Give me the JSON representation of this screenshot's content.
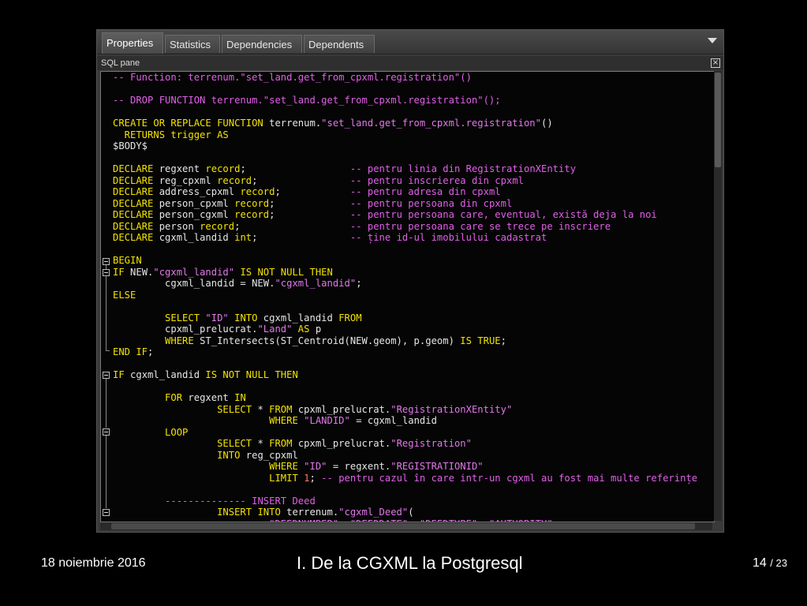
{
  "tabs": [
    {
      "label": "Properties",
      "active": true
    },
    {
      "label": "Statistics"
    },
    {
      "label": "Dependencies"
    },
    {
      "label": "Dependents"
    }
  ],
  "pane": {
    "title": "SQL pane",
    "close_icon": "close-icon"
  },
  "code_lines": [
    [
      [
        "cm",
        "-- Function: terrenum.\"set_land.get_from_cpxml.registration\"()"
      ]
    ],
    [],
    [
      [
        "cm",
        "-- DROP FUNCTION terrenum.\"set_land.get_from_cpxml.registration\"();"
      ]
    ],
    [],
    [
      [
        "kw",
        "CREATE OR REPLACE FUNCTION"
      ],
      [
        "t",
        " terrenum."
      ],
      [
        "str",
        "\"set_land.get_from_cpxml.registration\""
      ],
      [
        "t",
        "()"
      ]
    ],
    [
      [
        "kw",
        "  RETURNS trigger AS"
      ]
    ],
    [
      [
        "t",
        "$BODY$"
      ]
    ],
    [],
    [
      [
        "kw",
        "DECLARE"
      ],
      [
        "t",
        " regxent "
      ],
      [
        "kw",
        "record"
      ],
      [
        "t",
        ";                  "
      ],
      [
        "cm",
        "-- pentru linia din RegistrationXEntity"
      ]
    ],
    [
      [
        "kw",
        "DECLARE"
      ],
      [
        "t",
        " reg_cpxml "
      ],
      [
        "kw",
        "record"
      ],
      [
        "t",
        ";                "
      ],
      [
        "cm",
        "-- pentru inscrierea din cpxml"
      ]
    ],
    [
      [
        "kw",
        "DECLARE"
      ],
      [
        "t",
        " address_cpxml "
      ],
      [
        "kw",
        "record"
      ],
      [
        "t",
        ";            "
      ],
      [
        "cm",
        "-- pentru adresa din cpxml"
      ]
    ],
    [
      [
        "kw",
        "DECLARE"
      ],
      [
        "t",
        " person_cpxml "
      ],
      [
        "kw",
        "record"
      ],
      [
        "t",
        ";             "
      ],
      [
        "cm",
        "-- pentru persoana din cpxml"
      ]
    ],
    [
      [
        "kw",
        "DECLARE"
      ],
      [
        "t",
        " person_cgxml "
      ],
      [
        "kw",
        "record"
      ],
      [
        "t",
        ";             "
      ],
      [
        "cm",
        "-- pentru persoana care, eventual, există deja la noi"
      ]
    ],
    [
      [
        "kw",
        "DECLARE"
      ],
      [
        "t",
        " person "
      ],
      [
        "kw",
        "record"
      ],
      [
        "t",
        ";                   "
      ],
      [
        "cm",
        "-- pentru persoana care se trece pe inscriere"
      ]
    ],
    [
      [
        "kw",
        "DECLARE"
      ],
      [
        "t",
        " cgxml_landid "
      ],
      [
        "kw",
        "int"
      ],
      [
        "t",
        ";                "
      ],
      [
        "cm",
        "-- ține id-ul imobilului cadastrat"
      ]
    ],
    [],
    [
      [
        "kw",
        "BEGIN"
      ]
    ],
    [
      [
        "kw",
        "IF"
      ],
      [
        "t",
        " NEW."
      ],
      [
        "str",
        "\"cgxml_landid\""
      ],
      [
        "kw",
        " IS NOT NULL THEN"
      ]
    ],
    [
      [
        "t",
        "         cgxml_landid = NEW."
      ],
      [
        "str",
        "\"cgxml_landid\""
      ],
      [
        "t",
        ";"
      ]
    ],
    [
      [
        "kw",
        "ELSE"
      ]
    ],
    [],
    [
      [
        "t",
        "         "
      ],
      [
        "kw",
        "SELECT"
      ],
      [
        "t",
        " "
      ],
      [
        "str",
        "\"ID\""
      ],
      [
        "kw",
        " INTO"
      ],
      [
        "t",
        " cgxml_landid "
      ],
      [
        "kw",
        "FROM"
      ]
    ],
    [
      [
        "t",
        "         cpxml_prelucrat."
      ],
      [
        "str",
        "\"Land\""
      ],
      [
        "kw",
        " AS"
      ],
      [
        "t",
        " p"
      ]
    ],
    [
      [
        "t",
        "         "
      ],
      [
        "kw",
        "WHERE"
      ],
      [
        "t",
        " ST_Intersects(ST_Centroid(NEW.geom), p.geom) "
      ],
      [
        "kw",
        "IS TRUE"
      ],
      [
        "t",
        ";"
      ]
    ],
    [
      [
        "kw",
        "END IF"
      ],
      [
        "t",
        ";"
      ]
    ],
    [],
    [
      [
        "kw",
        "IF"
      ],
      [
        "t",
        " cgxml_landid "
      ],
      [
        "kw",
        "IS NOT NULL THEN"
      ]
    ],
    [],
    [
      [
        "t",
        "         "
      ],
      [
        "kw",
        "FOR"
      ],
      [
        "t",
        " regxent "
      ],
      [
        "kw",
        "IN"
      ]
    ],
    [
      [
        "t",
        "                  "
      ],
      [
        "kw",
        "SELECT"
      ],
      [
        "t",
        " * "
      ],
      [
        "kw",
        "FROM"
      ],
      [
        "t",
        " cpxml_prelucrat."
      ],
      [
        "str",
        "\"RegistrationXEntity\""
      ]
    ],
    [
      [
        "t",
        "                           "
      ],
      [
        "kw",
        "WHERE"
      ],
      [
        "t",
        " "
      ],
      [
        "str",
        "\"LANDID\""
      ],
      [
        "t",
        " = cgxml_landid"
      ]
    ],
    [
      [
        "t",
        "         "
      ],
      [
        "kw",
        "LOOP"
      ]
    ],
    [
      [
        "t",
        "                  "
      ],
      [
        "kw",
        "SELECT"
      ],
      [
        "t",
        " * "
      ],
      [
        "kw",
        "FROM"
      ],
      [
        "t",
        " cpxml_prelucrat."
      ],
      [
        "str",
        "\"Registration\""
      ]
    ],
    [
      [
        "t",
        "                  "
      ],
      [
        "kw",
        "INTO"
      ],
      [
        "t",
        " reg_cpxml"
      ]
    ],
    [
      [
        "t",
        "                           "
      ],
      [
        "kw",
        "WHERE"
      ],
      [
        "t",
        " "
      ],
      [
        "str",
        "\"ID\""
      ],
      [
        "t",
        " = regxent."
      ],
      [
        "str",
        "\"REGISTRATIONID\""
      ]
    ],
    [
      [
        "t",
        "                           "
      ],
      [
        "kw",
        "LIMIT"
      ],
      [
        "t",
        " "
      ],
      [
        "num",
        "1"
      ],
      [
        "t",
        "; "
      ],
      [
        "cm",
        "-- pentru cazul în care intr-un cgxml au fost mai multe referințe"
      ]
    ],
    [],
    [
      [
        "t",
        "         "
      ],
      [
        "cm",
        "-------------- INSERT Deed"
      ]
    ],
    [
      [
        "t",
        "                  "
      ],
      [
        "kw",
        "INSERT INTO"
      ],
      [
        "t",
        " terrenum."
      ],
      [
        "str",
        "\"cgxml_Deed\""
      ],
      [
        "t",
        "("
      ]
    ],
    [
      [
        "t",
        "                           "
      ],
      [
        "str",
        "\"DEEDNUMBER\", \"DEEDDATE\", \"DEEDTYPE\", \"AUTHORITY\""
      ]
    ]
  ],
  "footer": {
    "date": "18 noiembrie 2016",
    "title": "I. De la CGXML la Postgresql",
    "page": "14",
    "total": "/ 23"
  }
}
